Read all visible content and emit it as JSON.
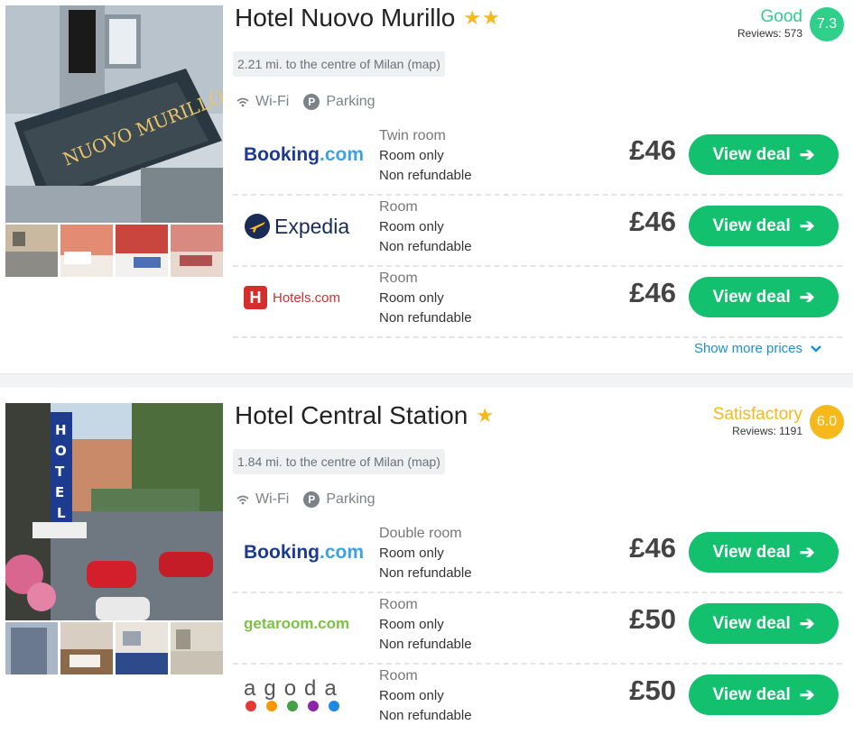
{
  "hotels": [
    {
      "name": "Hotel Nuovo Murillo",
      "stars": "★★",
      "rating_word": "Good",
      "rating_color": "#2ed08a",
      "reviews": "Reviews: 573",
      "score": "7.3",
      "distance": "2.21 mi. to the centre of Milan (map)",
      "amenities": [
        "Wi-Fi",
        "Parking"
      ],
      "deals": [
        {
          "provider": "Booking.com",
          "room": "Twin room",
          "board": "Room only",
          "refund": "Non refundable",
          "price": "£46",
          "button": "View deal"
        },
        {
          "provider": "Expedia",
          "room": "Room",
          "board": "Room only",
          "refund": "Non refundable",
          "price": "£46",
          "button": "View deal"
        },
        {
          "provider": "Hotels.com",
          "room": "Room",
          "board": "Room only",
          "refund": "Non refundable",
          "price": "£46",
          "button": "View deal"
        }
      ],
      "show_more": "Show more prices"
    },
    {
      "name": "Hotel Central Station",
      "stars": "★",
      "rating_word": "Satisfactory",
      "rating_color": "#f6b91b",
      "reviews": "Reviews: 1191",
      "score": "6.0",
      "distance": "1.84 mi. to the centre of Milan (map)",
      "amenities": [
        "Wi-Fi",
        "Parking"
      ],
      "deals": [
        {
          "provider": "Booking.com",
          "room": "Double room",
          "board": "Room only",
          "refund": "Non refundable",
          "price": "£46",
          "button": "View deal"
        },
        {
          "provider": "getaroom.com",
          "room": "Room",
          "board": "Room only",
          "refund": "Non refundable",
          "price": "£50",
          "button": "View deal"
        },
        {
          "provider": "agoda",
          "room": "Room",
          "board": "Room only",
          "refund": "Non refundable",
          "price": "£50",
          "button": "View deal"
        }
      ]
    }
  ],
  "logos": {
    "booking": {
      "part1": "Booking",
      "part2": ".com"
    },
    "expedia": "Expedia",
    "hotels": "Hotels.com",
    "getaroom": "getaroom.com",
    "agoda": "agoda",
    "expedia_letter": "H"
  },
  "colors": {
    "accent": "#13c06e",
    "link": "#1f8fd0",
    "booking_blue": "#1d3b8e",
    "booking_light": "#3fa1e0",
    "expedia_navy": "#1a2b55",
    "expedia_yellow": "#fcc30d",
    "hotels_red": "#d32f2f",
    "getaroom_green": "#7cc242"
  }
}
